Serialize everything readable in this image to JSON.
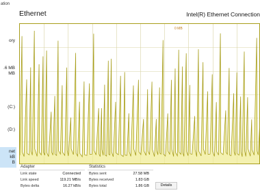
{
  "window": {
    "title": "ation"
  },
  "sidebar": {
    "items": [
      {
        "name": "memory",
        "lines": [
          "ory"
        ]
      },
      {
        "name": "disk-value",
        "lines": [
          ".6 MB",
          "MB"
        ]
      },
      {
        "name": "disk-c",
        "lines": [
          "(C:)",
          "",
          ""
        ]
      },
      {
        "name": "disk-d",
        "lines": [
          "(D:)"
        ]
      },
      {
        "name": "ethernet",
        "lines": [
          "net",
          "kB",
          "B"
        ],
        "selected": true
      }
    ]
  },
  "header": {
    "title": "Ethernet",
    "adapter_name": "Intel(R) Ethernet Connection"
  },
  "graph": {
    "label": "0 MB",
    "line_color": "#a79d19",
    "fill_color": "#f0ec95",
    "grid_color": "#d7d3a4"
  },
  "adapter": {
    "title": "Adapter",
    "rows": [
      {
        "label": "Link state",
        "value": "Connected"
      },
      {
        "label": "Link speed",
        "value": "119.21 MB/s"
      },
      {
        "label": "Bytes delta",
        "value": "16.27 kB/s"
      }
    ]
  },
  "statistics": {
    "title": "Statistics",
    "rows": [
      {
        "label": "Bytes sent",
        "value": "27.58 MB"
      },
      {
        "label": "Bytes received",
        "value": "1.83 GB"
      },
      {
        "label": "Bytes total",
        "value": "1.86 GB"
      }
    ]
  },
  "details_button": {
    "label": "Details"
  }
}
